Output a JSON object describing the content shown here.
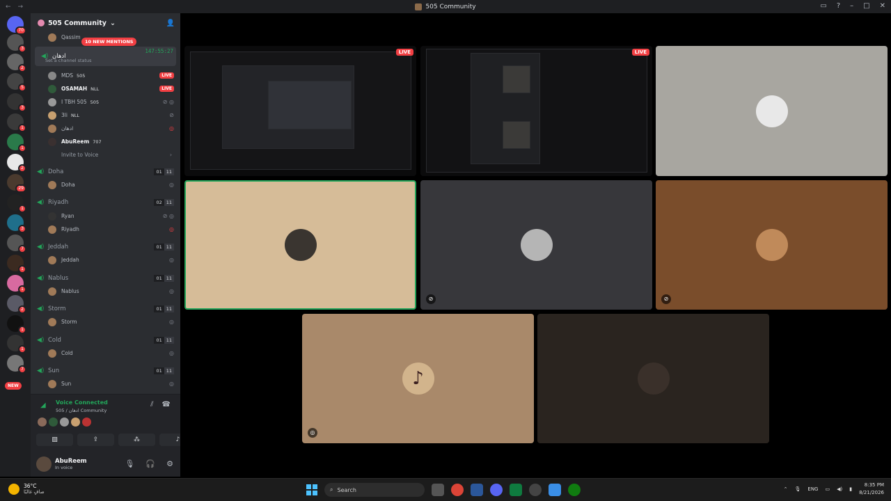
{
  "window": {
    "title": "505 Community"
  },
  "server": {
    "name": "505 Community"
  },
  "server_rail": {
    "new_label": "NEW",
    "badges": [
      "70",
      "3",
      "2",
      "5",
      "3",
      "1",
      "1",
      "2",
      "29",
      "1",
      "3",
      "7",
      "1",
      "1",
      "2",
      "1",
      "1",
      "7"
    ]
  },
  "mentions_pill": "10 NEW MENTIONS",
  "channels": {
    "qassim_user": "Qassim",
    "active": {
      "name": "ادهان",
      "timer": "147:55:27",
      "status": "Set a channel status"
    },
    "active_users": [
      {
        "name": "MDS",
        "tag": "505",
        "live": "LIVE"
      },
      {
        "name": "OSAMAH",
        "tag": "NLL",
        "live": "LIVE"
      },
      {
        "name": "I TBH 505",
        "tag": "505"
      },
      {
        "name": "3li",
        "tag": "NLL"
      },
      {
        "name": "ادهان"
      },
      {
        "name": "AbuReem",
        "tag": "707"
      }
    ],
    "invite": "Invite to Voice",
    "list": [
      {
        "name": "Doha",
        "c1": "01",
        "c2": "11",
        "user": "Doha"
      },
      {
        "name": "Riyadh",
        "c1": "02",
        "c2": "11",
        "user": "Ryan",
        "user2": "Riyadh"
      },
      {
        "name": "Jeddah",
        "c1": "01",
        "c2": "11",
        "user": "Jeddah"
      },
      {
        "name": "Nablus",
        "c1": "01",
        "c2": "11",
        "user": "Nablus"
      },
      {
        "name": "Storm",
        "c1": "01",
        "c2": "11",
        "user": "Storm"
      },
      {
        "name": "Cold",
        "c1": "01",
        "c2": "11",
        "user": "Cold"
      },
      {
        "name": "Sun",
        "c1": "01",
        "c2": "11",
        "user": "Sun"
      }
    ]
  },
  "voice": {
    "title": "Voice Connected",
    "subtitle": "ادهان / 505 Community"
  },
  "user_panel": {
    "name": "AbuReem",
    "status": "In voice"
  },
  "tiles": {
    "live": "LIVE"
  },
  "taskbar": {
    "temp": "36°C",
    "weather": "صافٍ غالبًا",
    "search": "Search",
    "lang": "ENG",
    "time": "8:35 PM",
    "date": "8/21/2026"
  },
  "colors": {
    "accent_green": "#23a55a",
    "live_red": "#f23f43",
    "blurple": "#5865f2"
  }
}
